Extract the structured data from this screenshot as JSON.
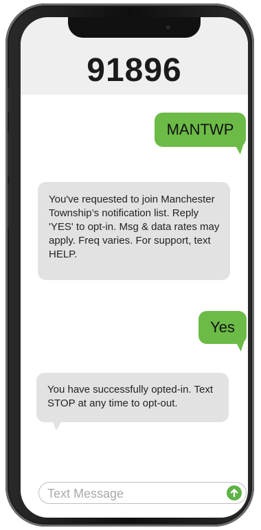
{
  "thread": {
    "contact": "91896"
  },
  "messages": [
    {
      "direction": "outgoing",
      "text": "MANTWP"
    },
    {
      "direction": "incoming",
      "text": "You've requested to join Manchester Township’s notification list. Reply 'YES' to opt-in. Msg & data rates may apply. Freq varies. For support, text HELP."
    },
    {
      "direction": "outgoing",
      "text": "Yes"
    },
    {
      "direction": "incoming",
      "text": "You have successfully opted-in. Text STOP at any time to opt-out."
    }
  ],
  "composer": {
    "placeholder": "Text Message",
    "send_icon": "arrow-up-icon",
    "send_color": "#5fb246"
  },
  "colors": {
    "outgoing_bubble": "#6cbb47",
    "incoming_bubble": "#e2e2e2",
    "header_bg": "#efefef"
  }
}
